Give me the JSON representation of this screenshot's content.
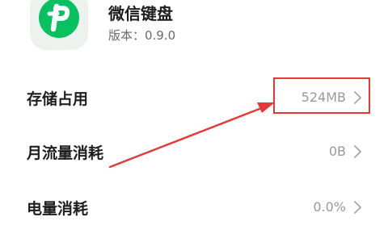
{
  "app": {
    "name": "微信键盘",
    "version_text": "版本：0.9.0",
    "icon": "wetype-logo",
    "icon_letter": "P",
    "brand_color": "#07c160"
  },
  "settings": {
    "storage": {
      "label": "存储占用",
      "value": "524MB"
    },
    "data_usage": {
      "label": "月流量消耗",
      "value": "0B"
    },
    "battery": {
      "label": "电量消耗",
      "value": "0.0%"
    }
  },
  "icons": {
    "row_chevron": "chevron-right-icon"
  },
  "annotation": {
    "color": "#e53935",
    "target": "storage-value"
  }
}
